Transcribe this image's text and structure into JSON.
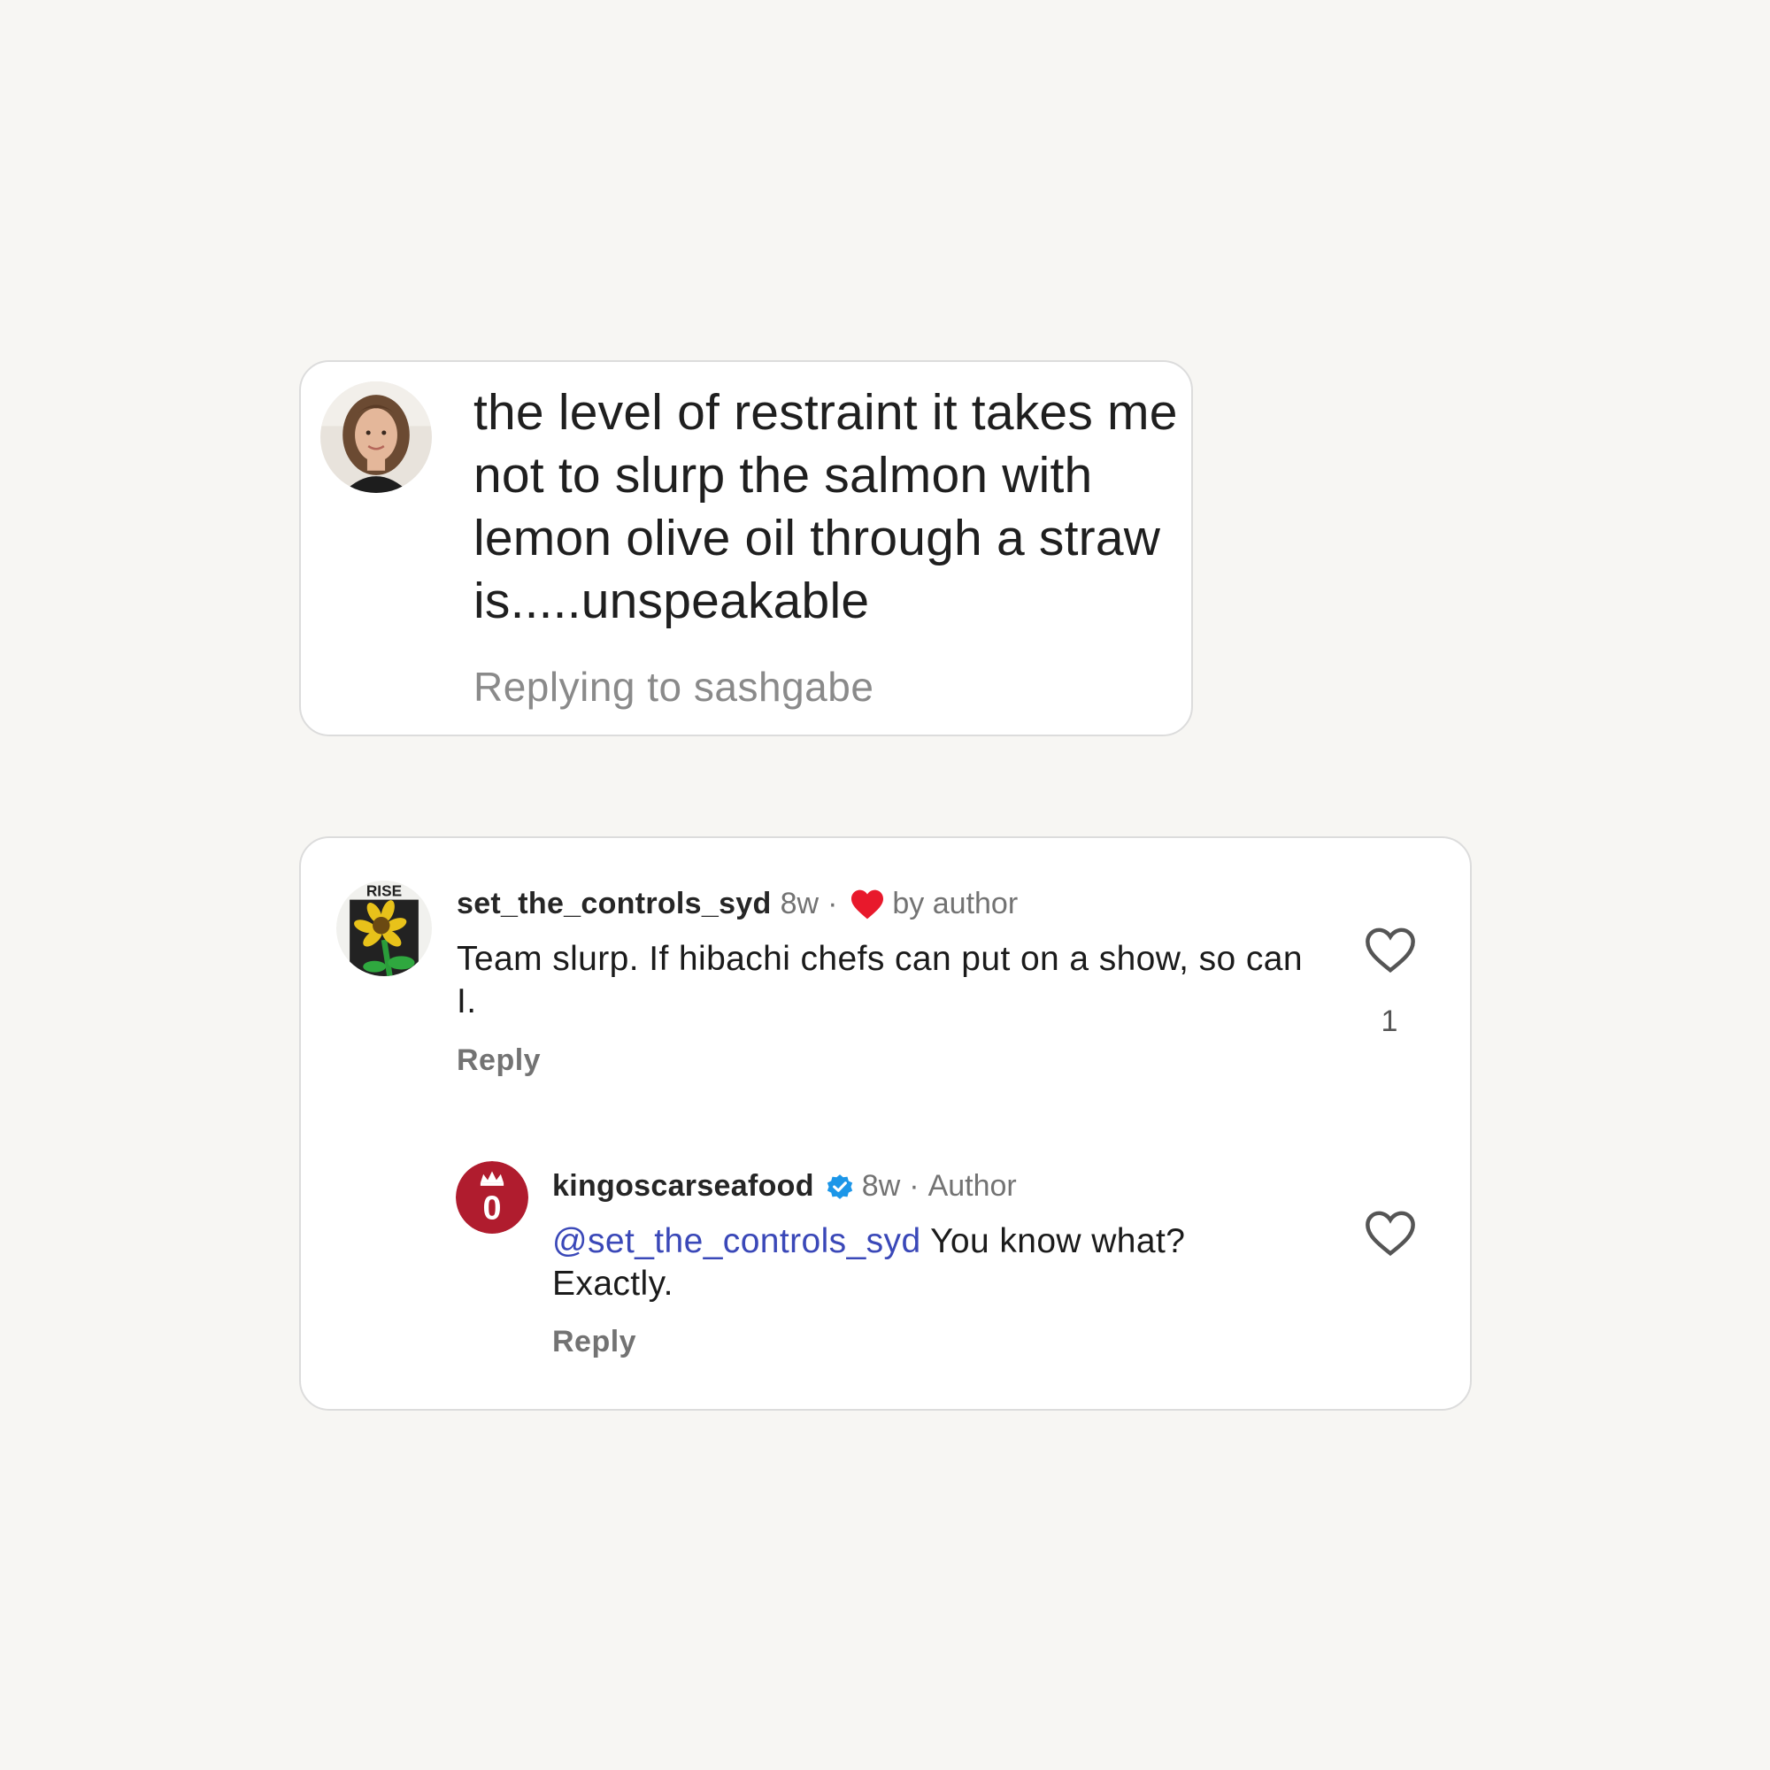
{
  "top_comment": {
    "text": "the level of restraint it takes me not to slurp the salmon with lemon olive oil through a straw is.....unspeakable",
    "replying_to": "Replying to sashgabe",
    "avatar_icon": "profile-photo"
  },
  "comments": [
    {
      "username": "set_the_controls_syd",
      "age": "8w",
      "separator": "·",
      "liked_by_author_label": "by author",
      "body": "Team slurp. If hibachi chefs can put on a show, so can I.",
      "reply_label": "Reply",
      "like_count": "1",
      "avatar_icon": "rise-sunflower-avatar",
      "avatar_text": "RISE"
    },
    {
      "username": "kingoscarseafood",
      "verified": true,
      "age": "8w",
      "separator": "·",
      "author_label": "Author",
      "mention": "@set_the_controls_syd",
      "body": "You know what? Exactly.",
      "reply_label": "Reply",
      "avatar_icon": "king-oscar-logo",
      "avatar_text": "0"
    }
  ],
  "colors": {
    "background": "#f7f6f3",
    "card": "#ffffff",
    "liked_heart": "#e8192c",
    "verified_badge": "#1c96e8",
    "mention": "#3a48b8",
    "brand_red": "#b01c2e"
  }
}
